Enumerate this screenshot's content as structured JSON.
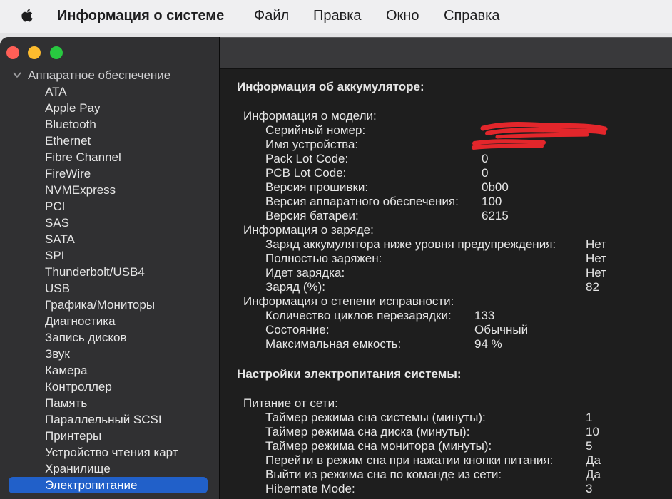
{
  "icons": {
    "apple": "apple-icon",
    "sidebar_chevron": "chevron-down-icon"
  },
  "colors": {
    "selection": "#2160c9",
    "close": "#ff5f57",
    "minimize": "#febc2e",
    "zoom": "#28c840",
    "redaction": "#e3262b"
  },
  "menubar": {
    "app_name": "Информация о системе",
    "menus": [
      "Файл",
      "Правка",
      "Окно",
      "Справка"
    ]
  },
  "sidebar": {
    "section": "Аппаратное обеспечение",
    "items": [
      "ATA",
      "Apple Pay",
      "Bluetooth",
      "Ethernet",
      "Fibre Channel",
      "FireWire",
      "NVMExpress",
      "PCI",
      "SAS",
      "SATA",
      "SPI",
      "Thunderbolt/USB4",
      "USB",
      "Графика/Мониторы",
      "Диагностика",
      "Запись дисков",
      "Звук",
      "Камера",
      "Контроллер",
      "Память",
      "Параллельный SCSI",
      "Принтеры",
      "Устройство чтения карт",
      "Хранилище",
      "Электропитание"
    ],
    "selected_index": 24
  },
  "battery": {
    "title": "Информация об аккумуляторе:",
    "model": {
      "title": "Информация о модели:",
      "rows": [
        {
          "label": "Серийный номер:",
          "value_redacted": true
        },
        {
          "label": "Имя устройства:",
          "value_redacted": true
        },
        {
          "label": "Pack Lot Code:",
          "value": "0"
        },
        {
          "label": "PCB Lot Code:",
          "value": "0"
        },
        {
          "label": "Версия прошивки:",
          "value": "0b00"
        },
        {
          "label": "Версия аппаратного обеспечения:",
          "value": "100"
        },
        {
          "label": "Версия батареи:",
          "value": "6215"
        }
      ]
    },
    "charge": {
      "title": "Информация о заряде:",
      "rows": [
        {
          "label": "Заряд аккумулятора ниже уровня предупреждения:",
          "value": "Нет"
        },
        {
          "label": "Полностью заряжен:",
          "value": "Нет"
        },
        {
          "label": "Идет зарядка:",
          "value": "Нет"
        },
        {
          "label": "Заряд (%):",
          "value": "82"
        }
      ]
    },
    "health": {
      "title": "Информация о степени исправности:",
      "rows": [
        {
          "label": "Количество циклов перезарядки:",
          "value": "133"
        },
        {
          "label": "Состояние:",
          "value": "Обычный"
        },
        {
          "label": "Максимальная емкость:",
          "value": "94 %"
        }
      ]
    }
  },
  "power": {
    "title": "Настройки электропитания системы:",
    "ac": {
      "title": "Питание от сети:",
      "rows": [
        {
          "label": "Таймер режима сна системы (минуты):",
          "value": "1"
        },
        {
          "label": "Таймер режима сна диска (минуты):",
          "value": "10"
        },
        {
          "label": "Таймер режима сна монитора (минуты):",
          "value": "5"
        },
        {
          "label": "Перейти в режим сна при нажатии кнопки питания:",
          "value": "Да"
        },
        {
          "label": "Выйти из режима сна по команде из сети:",
          "value": "Да"
        },
        {
          "label": "Hibernate Mode:",
          "value": "3"
        }
      ]
    }
  }
}
